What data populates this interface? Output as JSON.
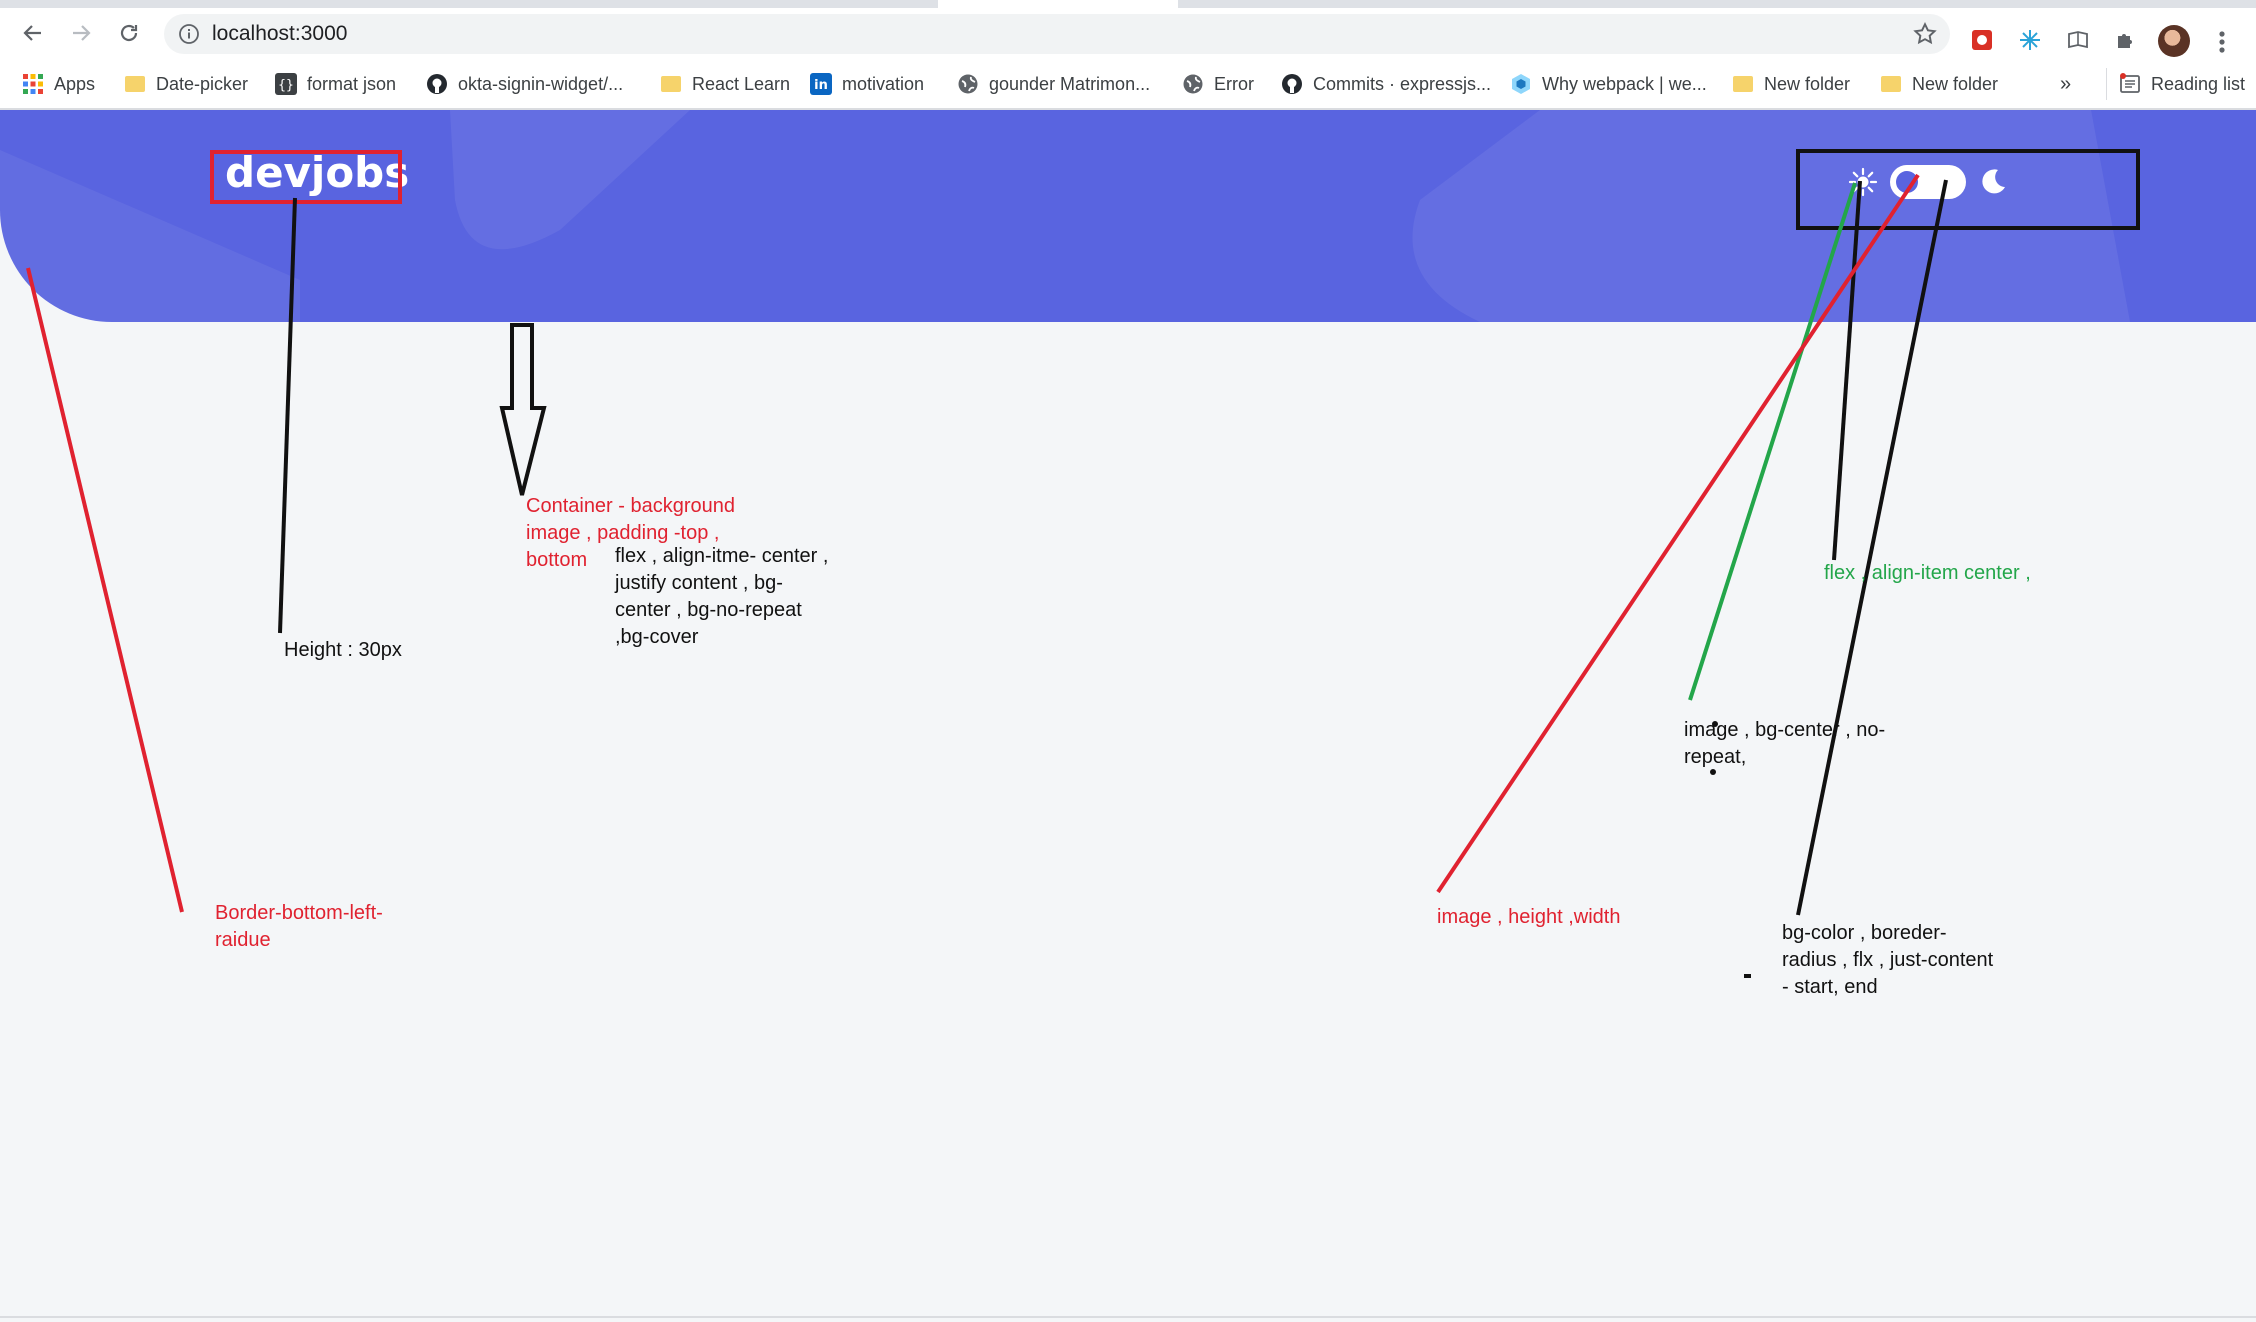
{
  "browser": {
    "url": "localhost:3000",
    "bookmarks": [
      {
        "label": "Apps",
        "icon": "apps-grid-icon"
      },
      {
        "label": "Date-picker",
        "icon": "folder-icon"
      },
      {
        "label": "format json",
        "icon": "json-braces-icon"
      },
      {
        "label": "okta-signin-widget/...",
        "icon": "github-icon"
      },
      {
        "label": "React Learn",
        "icon": "folder-icon"
      },
      {
        "label": "motivation",
        "icon": "linkedin-icon"
      },
      {
        "label": "gounder Matrimon...",
        "icon": "globe-icon"
      },
      {
        "label": "Error",
        "icon": "globe-icon"
      },
      {
        "label": "Commits · expressjs...",
        "icon": "github-icon"
      },
      {
        "label": "Why webpack | we...",
        "icon": "webpack-icon"
      },
      {
        "label": "New folder",
        "icon": "folder-icon"
      },
      {
        "label": "New folder",
        "icon": "folder-icon"
      }
    ],
    "overflow_label": "»",
    "reading_list": "Reading list"
  },
  "header": {
    "logo": "devjobs",
    "colors": {
      "primary": "#5964e0",
      "background": "#f4f6f8"
    }
  },
  "annotations": {
    "logo_height": "Height : 30px",
    "container": [
      "Container - background",
      "image , padding -top ,",
      "bottom"
    ],
    "container_flex": [
      "flex , align-itme- center ,",
      "justify content , bg-",
      "center , bg-no-repeat",
      ",bg-cover"
    ],
    "border_radius": [
      "Border-bottom-left-",
      "raidue"
    ],
    "toggle_flex": "flex , align-item center ,",
    "icon_image": [
      "image , bg-center , no-",
      "repeat,"
    ],
    "knob_image": "image , height ,width",
    "track": [
      "bg-color , boreder-",
      "radius , flx , just-content",
      "- start, end"
    ],
    "colors": {
      "red": "#e02230",
      "green": "#23a64a",
      "black": "#111111"
    }
  }
}
